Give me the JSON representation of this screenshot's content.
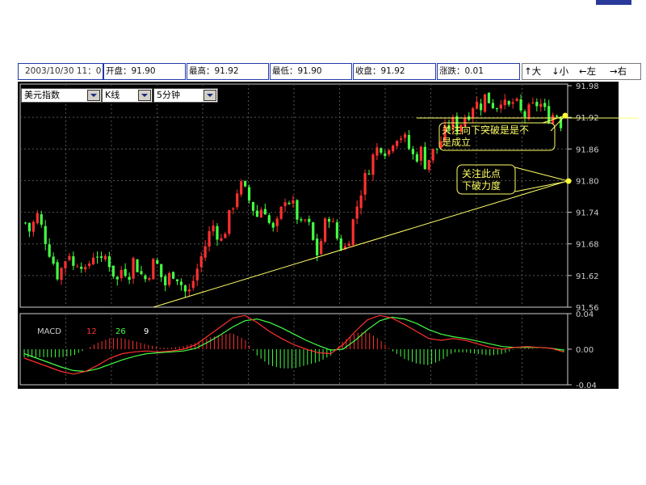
{
  "infobar": {
    "date": "2003/10/30 11：0",
    "open": "开盘：91.90",
    "high": "最高：91.92",
    "low": "最低：91.90",
    "close": "收盘：91.92",
    "change": "涨跌：0.01",
    "nav": {
      "up": "↑大",
      "down": "↓小",
      "left": "←左",
      "right": "→右"
    }
  },
  "controls": {
    "symbol": "美元指数",
    "chart_style": "K线",
    "period": "5分钟"
  },
  "colors": {
    "bull": "#ff3030",
    "bear": "#44ff44",
    "grid": "#555555",
    "trendline": "#ffff66",
    "annotation": "#ffff66",
    "macd_fast": "#ff3030",
    "macd_slow": "#44ff44"
  },
  "annotations": {
    "note1": [
      "关注向下突破是是不",
      "是成立"
    ],
    "note2": [
      "关注此点",
      "下破力度"
    ]
  },
  "macd": {
    "label": "MACD",
    "fast": "12",
    "slow": "26",
    "signal": "9"
  },
  "chart_data": [
    {
      "type": "candlestick",
      "title": "",
      "ylim": [
        91.56,
        91.98
      ],
      "yticks": [
        "91.98",
        "91.92",
        "91.86",
        "91.80",
        "91.74",
        "91.68",
        "91.62",
        "91.56"
      ],
      "trendline": {
        "from_price": 91.56,
        "to_price": 91.8
      },
      "close_path": [
        91.72,
        91.7,
        91.74,
        91.71,
        91.68,
        91.65,
        91.62,
        91.64,
        91.67,
        91.63,
        91.66,
        91.62,
        91.65,
        91.67,
        91.64,
        91.66,
        91.63,
        91.61,
        91.64,
        91.62,
        91.65,
        91.63,
        91.61,
        91.63,
        91.65,
        91.62,
        91.6,
        91.63,
        91.62,
        91.6,
        91.58,
        91.61,
        91.64,
        91.67,
        91.7,
        91.72,
        91.68,
        91.71,
        91.74,
        91.78,
        91.79,
        91.77,
        91.75,
        91.73,
        91.76,
        91.72,
        91.7,
        91.73,
        91.77,
        91.76,
        91.74,
        91.71,
        91.73,
        91.69,
        91.66,
        91.7,
        91.74,
        91.71,
        91.68,
        91.67,
        91.7,
        91.74,
        91.78,
        91.81,
        91.84,
        91.86,
        91.87,
        91.85,
        91.88,
        91.89,
        91.88,
        91.86,
        91.84,
        91.86,
        91.83,
        91.85,
        91.86,
        91.88,
        91.9,
        91.91,
        91.9,
        91.92,
        91.93,
        91.95,
        91.94,
        91.96,
        91.95,
        91.94,
        91.96,
        91.93,
        91.95,
        91.94,
        91.92,
        91.93,
        91.94,
        91.95,
        91.93,
        91.92,
        91.93,
        91.91
      ]
    },
    {
      "type": "line",
      "title": "MACD",
      "ylim": [
        -0.04,
        0.04
      ],
      "yticks": [
        "0.04",
        "0.00",
        "-0.04"
      ],
      "series": [
        {
          "name": "12",
          "values": [
            -0.01,
            -0.015,
            -0.02,
            -0.025,
            -0.028,
            -0.025,
            -0.018,
            -0.01,
            -0.005,
            -0.003,
            -0.002,
            -0.003,
            -0.002,
            0.0,
            0.005,
            0.015,
            0.025,
            0.035,
            0.038,
            0.03,
            0.02,
            0.012,
            0.005,
            0.0,
            -0.004,
            -0.005,
            0.005,
            0.02,
            0.033,
            0.038,
            0.035,
            0.028,
            0.02,
            0.012,
            0.01,
            0.012,
            0.01,
            0.006,
            0.002,
            0.0,
            0.002,
            0.003,
            0.002,
            0.001,
            -0.003
          ]
        },
        {
          "name": "26",
          "values": [
            -0.005,
            -0.01,
            -0.015,
            -0.02,
            -0.024,
            -0.025,
            -0.022,
            -0.017,
            -0.012,
            -0.008,
            -0.005,
            -0.004,
            -0.003,
            -0.002,
            0.001,
            0.008,
            0.016,
            0.025,
            0.032,
            0.034,
            0.03,
            0.024,
            0.017,
            0.01,
            0.004,
            -0.001,
            0.0,
            0.01,
            0.022,
            0.032,
            0.036,
            0.034,
            0.029,
            0.022,
            0.017,
            0.014,
            0.012,
            0.009,
            0.006,
            0.003,
            0.002,
            0.002,
            0.002,
            0.001,
            -0.001
          ]
        }
      ]
    }
  ]
}
